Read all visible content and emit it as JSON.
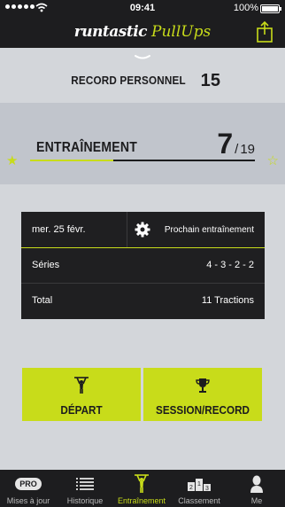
{
  "status": {
    "time": "09:41",
    "battery": "100%"
  },
  "header": {
    "brand": "runtastic",
    "product": "PullUps",
    "share_icon": "share-icon"
  },
  "record": {
    "label": "RECORD PERSONNEL",
    "value": "15"
  },
  "training": {
    "label": "ENTRAÎNEMENT",
    "current": "7",
    "separator": "/",
    "total": "19",
    "progress_fraction": 0.37,
    "star_icon": "star-icon"
  },
  "card": {
    "date": "mer. 25 févr.",
    "next_label": "Prochain entraînement",
    "series_label": "Séries",
    "series_value": "4 - 3 - 2 - 2",
    "total_label": "Total",
    "total_value": "11 Tractions"
  },
  "actions": {
    "start_label": "DÉPART",
    "session_label": "SESSION/RECORD"
  },
  "tabs": [
    {
      "label": "Mises à jour",
      "badge": "PRO"
    },
    {
      "label": "Historique"
    },
    {
      "label": "Entraînement"
    },
    {
      "label": "Classement",
      "podium": [
        "2",
        "1",
        "3"
      ]
    },
    {
      "label": "Me"
    }
  ],
  "colors": {
    "accent": "#c8dc1a",
    "dark": "#1d1d1f",
    "background": "#d3d6da",
    "band": "#c1c5cc"
  }
}
